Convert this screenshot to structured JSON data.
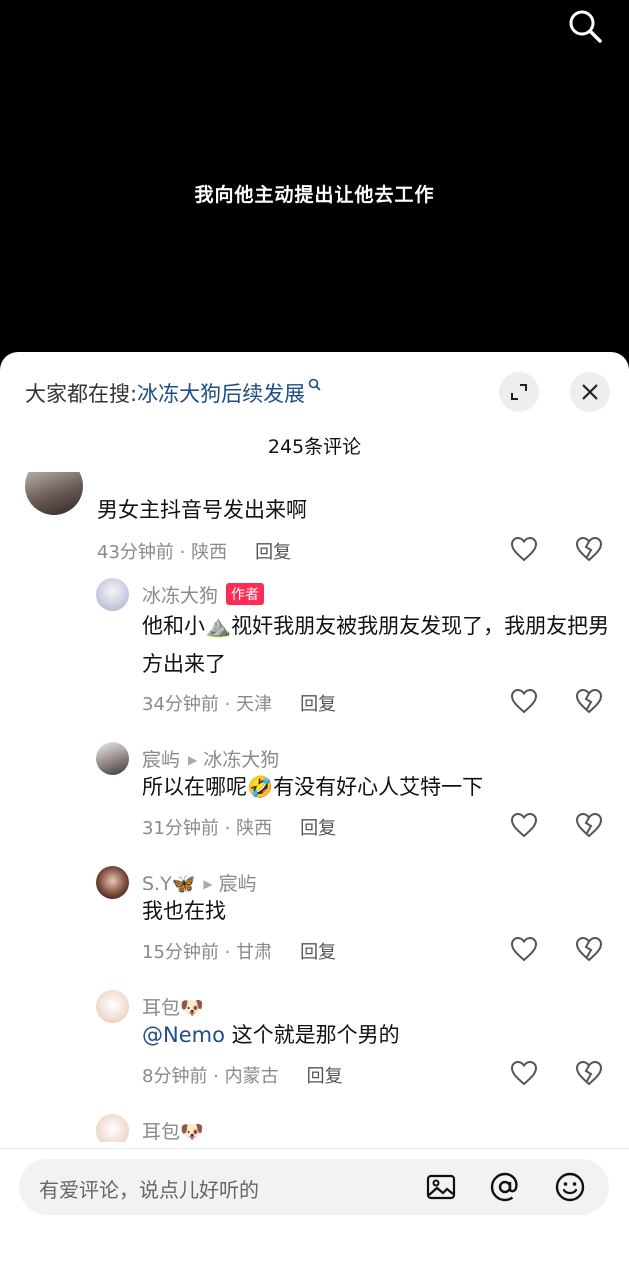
{
  "video": {
    "subtitle": "我向他主动提出让他去工作"
  },
  "search_bar": {
    "prefix": "大家都在搜:",
    "keyword": "冰冻大狗后续发展"
  },
  "comment_count": "245条评论",
  "comments": [
    {
      "name": "",
      "text": "男女主抖音号发出来啊",
      "time_loc": "43分钟前 · 陕西",
      "reply": "回复"
    },
    {
      "name": "冰冻大狗",
      "badge": "作者",
      "text": "他和小⛰️视奸我朋友被我朋友发现了，我朋友把男方出来了",
      "time_loc": "34分钟前 · 天津",
      "reply": "回复"
    },
    {
      "name": "宸屿",
      "reply_to": "冰冻大狗",
      "text": "所以在哪呢🤣有没有好心人艾特一下",
      "time_loc": "31分钟前 · 陕西",
      "reply": "回复"
    },
    {
      "name": "S.Y🦋",
      "reply_to": "宸屿",
      "text": "我也在找",
      "time_loc": "15分钟前 · 甘肃",
      "reply": "回复"
    },
    {
      "name": "耳包🐶",
      "mention": "@Nemo",
      "text": " 这个就是那个男的",
      "time_loc": "8分钟前 · 内蒙古",
      "reply": "回复"
    },
    {
      "name": "耳包🐶"
    }
  ],
  "input": {
    "placeholder": "有爱评论，说点儿好听的"
  },
  "icons": {
    "search": "search-icon",
    "expand": "expand-icon",
    "close": "close-icon",
    "like": "heart-icon",
    "dislike": "broken-heart-icon",
    "image": "image-icon",
    "at": "at-icon",
    "emoji": "emoji-icon"
  },
  "colors": {
    "link": "#1d4e89",
    "badge": "#fe2c55"
  }
}
